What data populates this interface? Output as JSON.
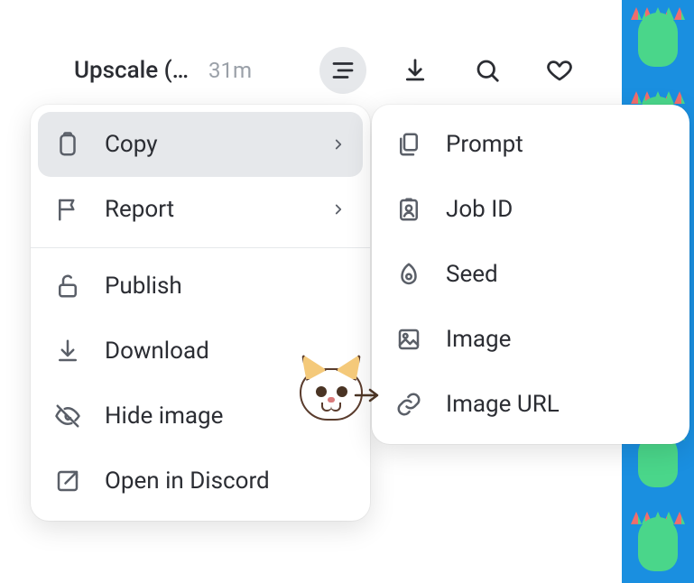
{
  "toolbar": {
    "title": "Upscale (…",
    "time": "31m"
  },
  "main_menu": {
    "items": [
      {
        "label": "Copy",
        "submenu": true,
        "highlight": true,
        "icon": "clipboard"
      },
      {
        "label": "Report",
        "submenu": true,
        "icon": "flag"
      },
      {
        "label": "Publish",
        "icon": "unlock"
      },
      {
        "label": "Download",
        "icon": "download"
      },
      {
        "label": "Hide image",
        "icon": "eye-off"
      },
      {
        "label": "Open in Discord",
        "icon": "external"
      }
    ]
  },
  "copy_submenu": {
    "items": [
      {
        "label": "Prompt",
        "icon": "copy-doc"
      },
      {
        "label": "Job ID",
        "icon": "id-badge"
      },
      {
        "label": "Seed",
        "icon": "seed"
      },
      {
        "label": "Image",
        "icon": "image"
      },
      {
        "label": "Image URL",
        "icon": "link"
      }
    ]
  }
}
